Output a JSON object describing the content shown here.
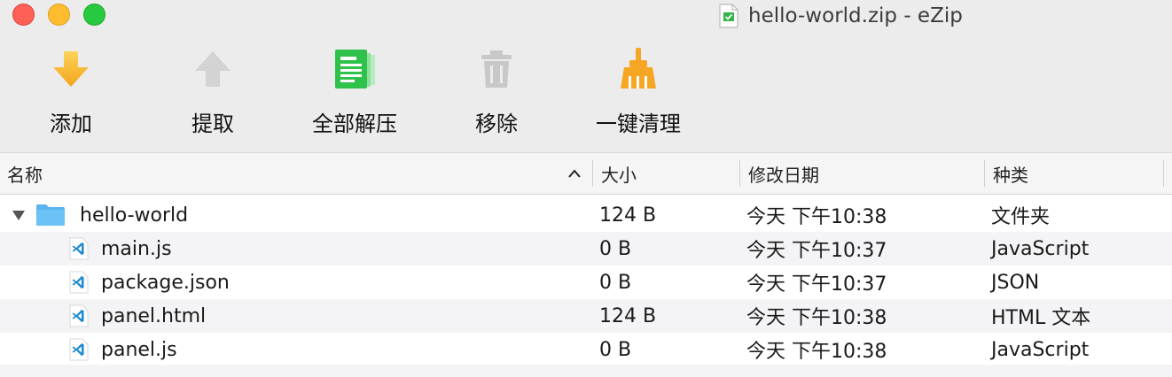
{
  "window": {
    "title": "hello-world.zip - eZip"
  },
  "toolbar": {
    "add": {
      "label": "添加",
      "icon": "download-arrow-icon",
      "color": "#f5b52e"
    },
    "extract": {
      "label": "提取",
      "icon": "upload-arrow-icon",
      "color": "#d0d0d0"
    },
    "extract_all": {
      "label": "全部解压",
      "icon": "documents-icon",
      "color": "#2fc24a"
    },
    "remove": {
      "label": "移除",
      "icon": "trash-icon",
      "color": "#d0d0d0"
    },
    "clean": {
      "label": "一键清理",
      "icon": "broom-icon",
      "color": "#f5a623"
    }
  },
  "columns": {
    "name": "名称",
    "size": "大小",
    "modified": "修改日期",
    "kind": "种类"
  },
  "rows": [
    {
      "name": "hello-world",
      "size": "124 B",
      "modified": "今天 下午10:38",
      "kind": "文件夹",
      "icon": "folder-icon"
    },
    {
      "name": "main.js",
      "size": "0 B",
      "modified": "今天 下午10:37",
      "kind": "JavaScript",
      "icon": "vscode-file-icon"
    },
    {
      "name": "package.json",
      "size": "0 B",
      "modified": "今天 下午10:37",
      "kind": "JSON",
      "icon": "vscode-file-icon"
    },
    {
      "name": "panel.html",
      "size": "124 B",
      "modified": "今天 下午10:38",
      "kind": "HTML 文本",
      "icon": "vscode-file-icon"
    },
    {
      "name": "panel.js",
      "size": "0 B",
      "modified": "今天 下午10:38",
      "kind": "JavaScript",
      "icon": "vscode-file-icon"
    }
  ],
  "colors": {
    "folder": "#5ab4f0",
    "vscode": "#1f8ad2",
    "alt_row": "#f4f4f6"
  }
}
